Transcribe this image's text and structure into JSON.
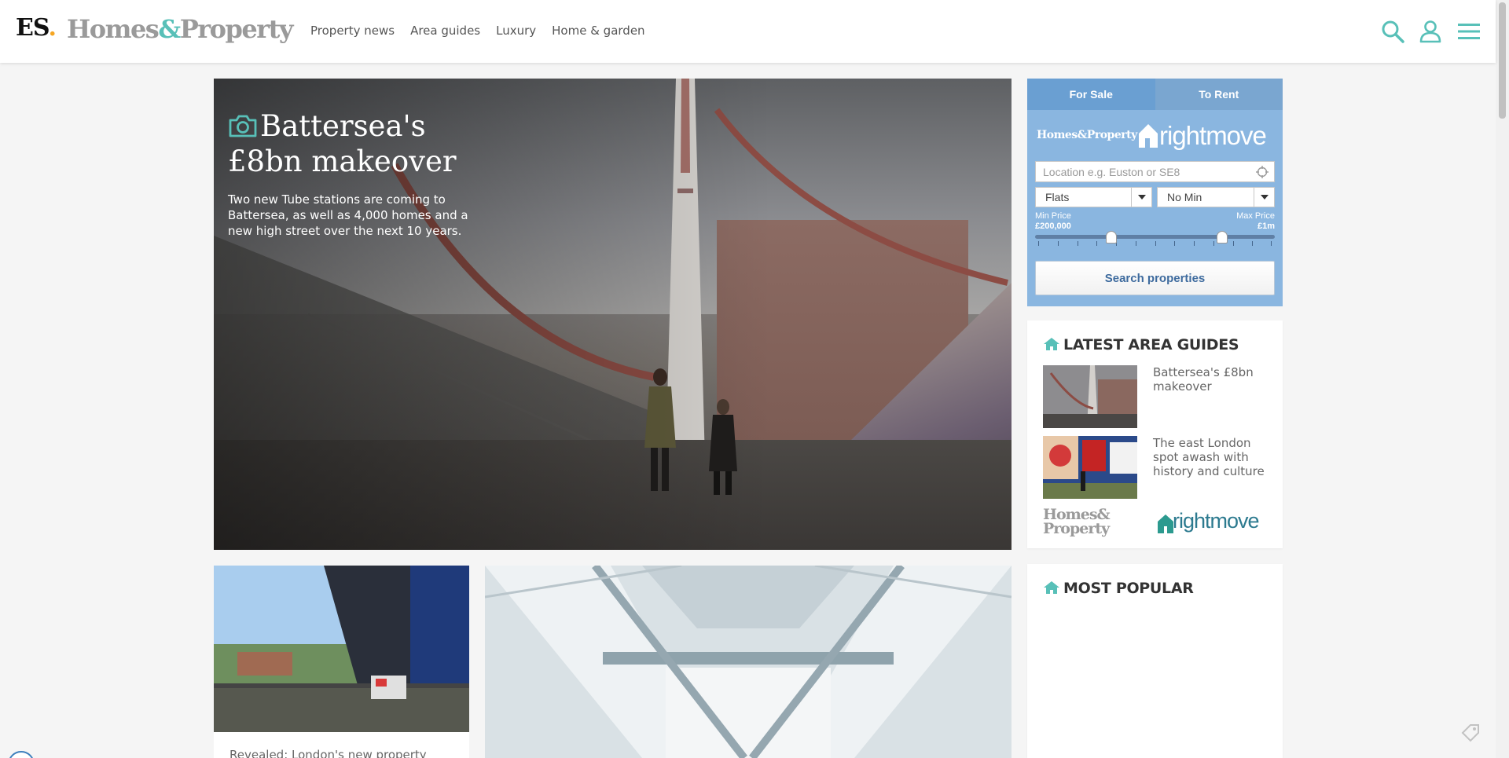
{
  "header": {
    "logo_es": "ES",
    "logo_es_dot": ".",
    "logo_homes": "Homes",
    "logo_amp": "&",
    "logo_property": "Property",
    "nav": [
      "Property news",
      "Area guides",
      "Luxury",
      "Home & garden"
    ],
    "icons": [
      "search-icon",
      "user-icon",
      "menu-icon"
    ],
    "accent_color": "#58c0b8"
  },
  "hero": {
    "title_line1": "Battersea's",
    "title_line2": "£8bn makeover",
    "subtitle": "Two new Tube stations are coming to Battersea, as well as 4,000 homes and a new high street over the next 10 years.",
    "icon": "camera-icon"
  },
  "property_search": {
    "tabs": [
      {
        "label": "For Sale",
        "active": true
      },
      {
        "label": "To Rent",
        "active": false
      }
    ],
    "brand_hp": "Homes&Property",
    "brand_rm": "rightmove",
    "location_placeholder": "Location e.g. Euston or SE8",
    "property_type": "Flats",
    "min_bedrooms": "No Min",
    "min_price_label": "Min Price",
    "min_price_value": "£200,000",
    "max_price_label": "Max Price",
    "max_price_value": "£1m",
    "search_button": "Search properties",
    "bg_color": "#8ab6e0"
  },
  "area_guides": {
    "title": "LATEST AREA GUIDES",
    "items": [
      {
        "text": "Battersea's £8bn makeover"
      },
      {
        "text": "The east London spot awash with history and culture"
      }
    ],
    "footer_hp_line1": "Homes&",
    "footer_hp_line2": "Property",
    "footer_rm": "rightmove"
  },
  "most_popular": {
    "title": "MOST POPULAR"
  },
  "articles": [
    {
      "caption": "Revealed: London's new property"
    }
  ]
}
